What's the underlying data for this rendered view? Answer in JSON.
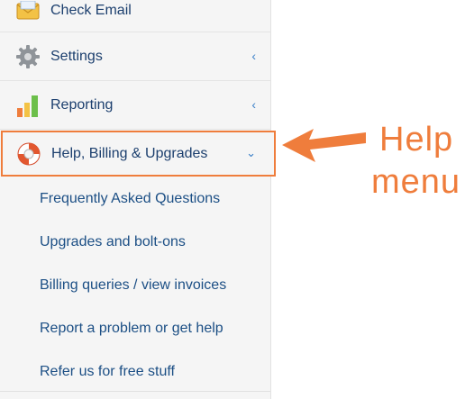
{
  "sidebar": {
    "items": [
      {
        "label": "Check Email",
        "icon": "envelope-icon"
      },
      {
        "label": "Settings",
        "icon": "gear-icon",
        "chevron": "‹"
      },
      {
        "label": "Reporting",
        "icon": "bar-chart-icon",
        "chevron": "‹"
      },
      {
        "label": "Help, Billing & Upgrades",
        "icon": "lifebuoy-icon",
        "chevron": "⌄"
      }
    ],
    "submenu": [
      {
        "label": "Frequently Asked Questions"
      },
      {
        "label": "Upgrades and bolt-ons"
      },
      {
        "label": "Billing queries / view invoices"
      },
      {
        "label": "Report a problem or get help"
      },
      {
        "label": "Refer us for free stuff"
      }
    ]
  },
  "annotation": {
    "line1": "Help",
    "line2": "menu",
    "color": "#ef7d3c"
  }
}
